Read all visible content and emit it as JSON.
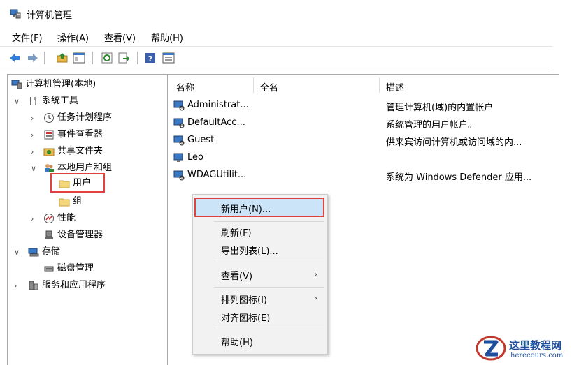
{
  "window": {
    "title": "计算机管理"
  },
  "menu": [
    "文件(F)",
    "操作(A)",
    "查看(V)",
    "帮助(H)"
  ],
  "toolbar": {
    "icons": [
      "back-icon",
      "forward-icon",
      "up-folder-icon",
      "show-hide-tree-icon",
      "refresh-icon",
      "export-list-icon",
      "help-icon",
      "properties-icon"
    ]
  },
  "tree": {
    "root": "计算机管理(本地)",
    "system_tools": "系统工具",
    "task_scheduler": "任务计划程序",
    "event_viewer": "事件查看器",
    "shared_folders": "共享文件夹",
    "local_users_groups": "本地用户和组",
    "users": "用户",
    "groups": "组",
    "performance": "性能",
    "device_manager": "设备管理器",
    "storage": "存储",
    "disk_management": "磁盘管理",
    "services_apps": "服务和应用程序"
  },
  "list": {
    "headers": {
      "name": "名称",
      "full_name": "全名",
      "description": "描述"
    },
    "rows": [
      {
        "name": "Administrat...",
        "full_name": "",
        "description": "管理计算机(域)的内置帐户"
      },
      {
        "name": "DefaultAcc...",
        "full_name": "",
        "description": "系统管理的用户帐户。"
      },
      {
        "name": "Guest",
        "full_name": "",
        "description": "供来宾访问计算机或访问域的内..."
      },
      {
        "name": "Leo",
        "full_name": "",
        "description": ""
      },
      {
        "name": "WDAGUtilit...",
        "full_name": "",
        "description": "系统为 Windows Defender 应用..."
      }
    ]
  },
  "context_menu": {
    "new_user": "新用户(N)...",
    "refresh": "刷新(F)",
    "export_list": "导出列表(L)...",
    "view": "查看(V)",
    "arrange_icons": "排列图标(I)",
    "align_icons": "对齐图标(E)",
    "help": "帮助(H)"
  },
  "watermark": {
    "name": "这里教程网",
    "url": "herecours.com"
  },
  "colors": {
    "highlight_border": "#e0423d",
    "selected_bg": "#cce4f7",
    "brand_blue": "#1d4f9c"
  }
}
